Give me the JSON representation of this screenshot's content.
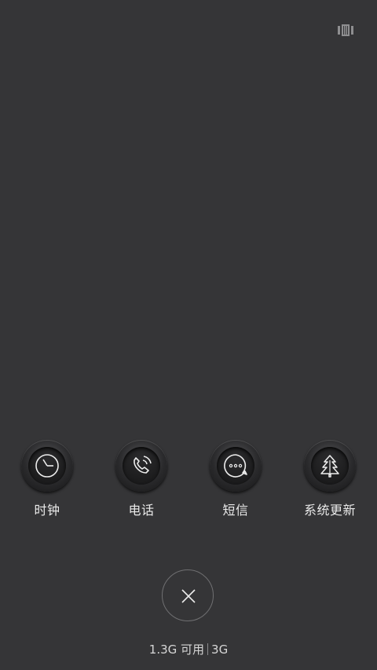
{
  "header": {
    "icon": "carousel-view-icon"
  },
  "apps": [
    {
      "label": "时钟",
      "icon": "clock-icon"
    },
    {
      "label": "电话",
      "icon": "phone-icon"
    },
    {
      "label": "短信",
      "icon": "message-icon"
    },
    {
      "label": "系统更新",
      "icon": "system-update-icon"
    }
  ],
  "footer": {
    "close_icon": "close-icon",
    "memory_available": "1.3G 可用",
    "memory_total": "3G"
  },
  "colors": {
    "background": "#353537",
    "text": "#eaeaea"
  }
}
